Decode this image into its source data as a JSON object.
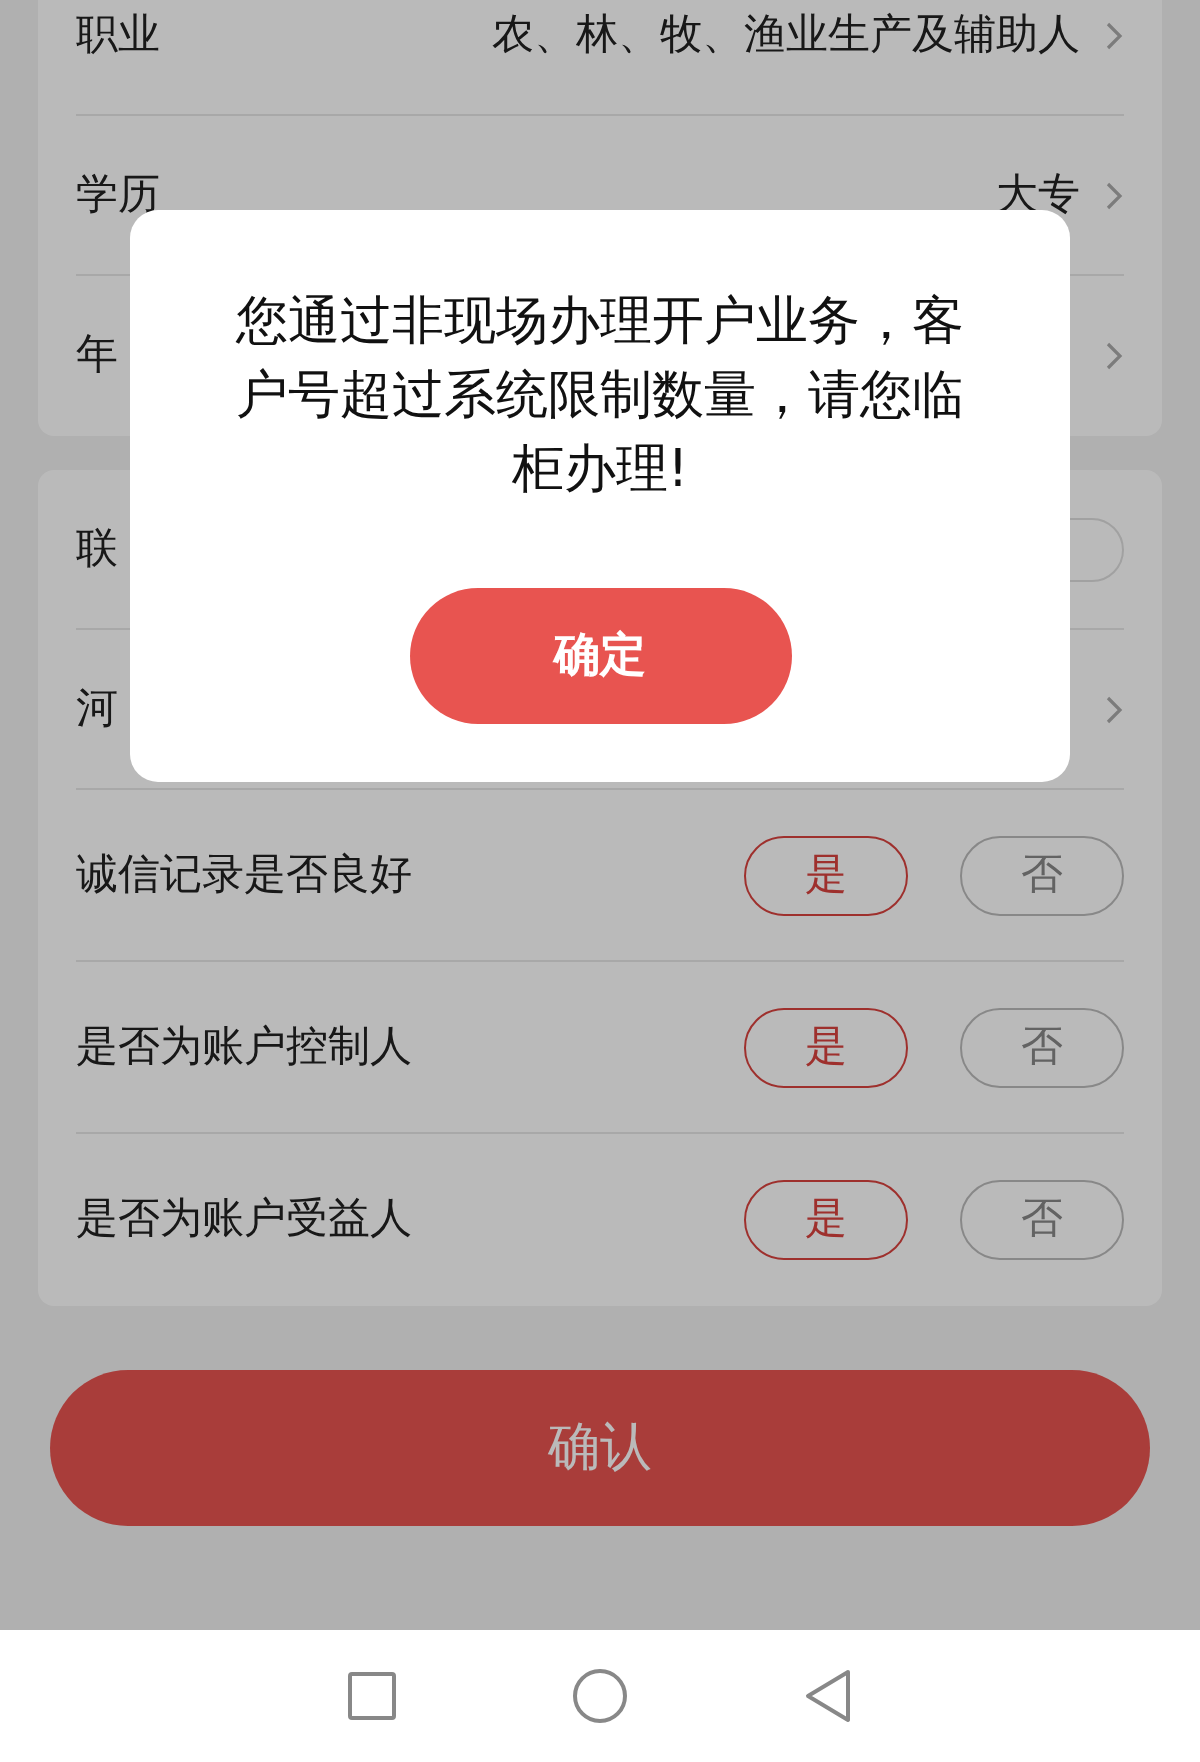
{
  "sections": [
    {
      "rows": [
        {
          "kind": "select",
          "label": "职业",
          "value": "农、林、牧、渔业生产及辅助人"
        },
        {
          "kind": "select",
          "label": "学历",
          "value": "大专"
        },
        {
          "kind": "select",
          "label": "年"
        }
      ]
    },
    {
      "rows": [
        {
          "kind": "toggle",
          "label": "联",
          "on": false
        },
        {
          "kind": "select",
          "label": "河"
        },
        {
          "kind": "choice",
          "label": "诚信记录是否良好",
          "options": [
            {
              "label": "是",
              "selected": true
            },
            {
              "label": "否",
              "selected": false
            }
          ]
        },
        {
          "kind": "choice",
          "label": "是否为账户控制人",
          "options": [
            {
              "label": "是",
              "selected": true
            },
            {
              "label": "否",
              "selected": false
            }
          ]
        },
        {
          "kind": "choice",
          "label": "是否为账户受益人",
          "options": [
            {
              "label": "是",
              "selected": true
            },
            {
              "label": "否",
              "selected": false
            }
          ]
        }
      ]
    }
  ],
  "confirm_button": "确认",
  "dialog": {
    "message": "您通过非现场办理开户业务，客户号超过系统限制数量，请您临柜办理!",
    "button": "确定"
  }
}
